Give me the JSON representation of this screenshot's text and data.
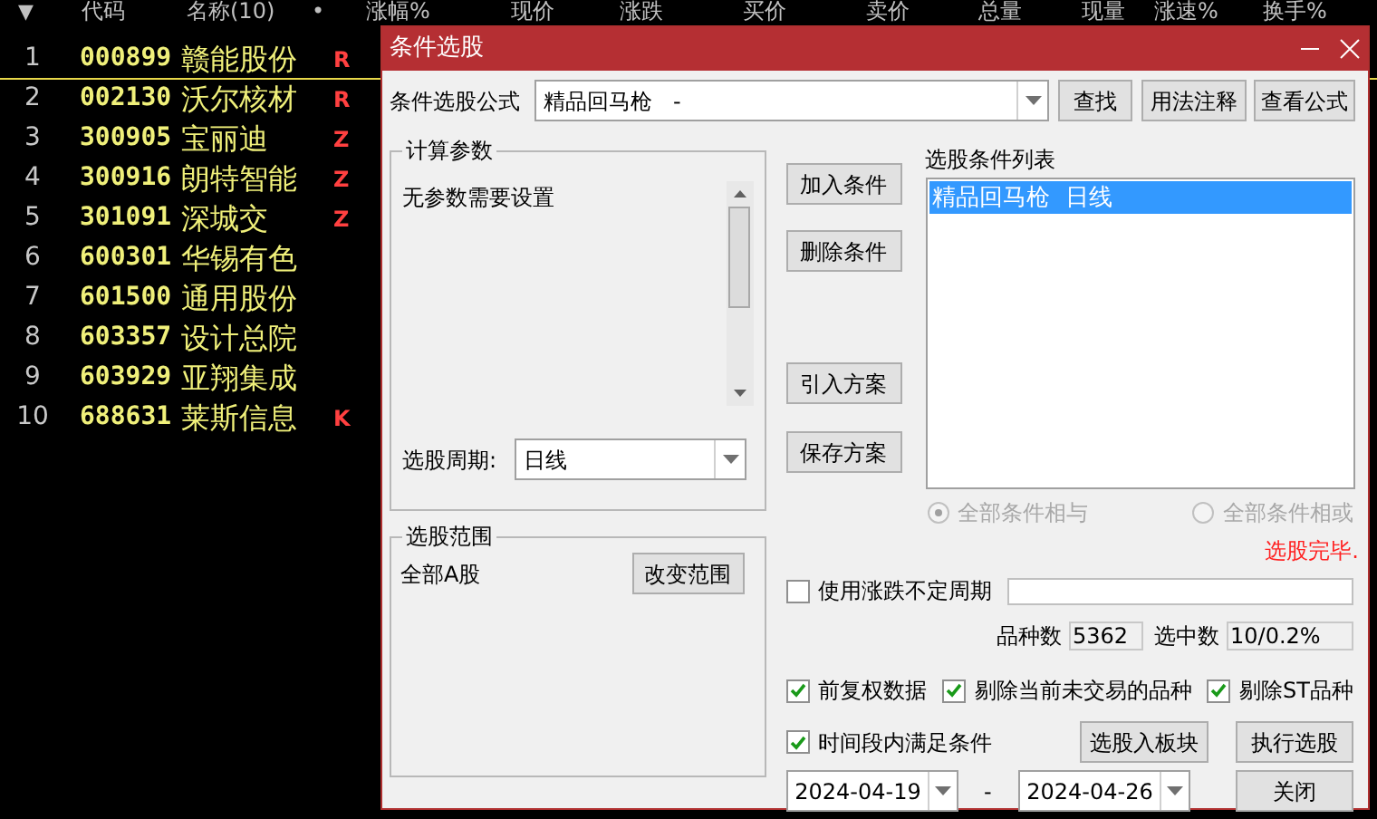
{
  "header": {
    "sort_icon": "▼",
    "columns": [
      "代码",
      "名称(10)",
      "•",
      "涨幅%",
      "现价",
      "涨跌",
      "买价",
      "卖价",
      "总量",
      "现量",
      "涨速%",
      "换手%"
    ]
  },
  "rows": [
    {
      "index": "1",
      "code": "000899",
      "name": "赣能股份",
      "mark": "R",
      "selected": true
    },
    {
      "index": "2",
      "code": "002130",
      "name": "沃尔核材",
      "mark": "R",
      "selected": false
    },
    {
      "index": "3",
      "code": "300905",
      "name": "宝丽迪",
      "mark": "Z",
      "selected": false
    },
    {
      "index": "4",
      "code": "300916",
      "name": "朗特智能",
      "mark": "Z",
      "selected": false
    },
    {
      "index": "5",
      "code": "301091",
      "name": "深城交",
      "mark": "Z",
      "selected": false
    },
    {
      "index": "6",
      "code": "600301",
      "name": "华锡有色",
      "selected": false
    },
    {
      "index": "7",
      "code": "601500",
      "name": "通用股份",
      "selected": false
    },
    {
      "index": "8",
      "code": "603357",
      "name": "设计总院",
      "selected": false
    },
    {
      "index": "9",
      "code": "603929",
      "name": "亚翔集成",
      "selected": false
    },
    {
      "index": "10",
      "code": "688631",
      "name": "莱斯信息",
      "mark": "K",
      "selected": false
    }
  ],
  "dialog": {
    "title": "条件选股",
    "formula_label": "条件选股公式",
    "formula_value": "精品回马枪   -",
    "top_buttons": [
      "查找",
      "用法注释",
      "查看公式"
    ],
    "params": {
      "title": "计算参数",
      "message": "无参数需要设置"
    },
    "period": {
      "label": "选股周期:",
      "value": "日线"
    },
    "range": {
      "title": "选股范围",
      "value": "全部A股",
      "button": "改变范围"
    },
    "middle_buttons": [
      "加入条件",
      "删除条件",
      "引入方案",
      "保存方案"
    ],
    "condition_list": {
      "label": "选股条件列表",
      "items": [
        {
          "text": "精品回马枪  日线",
          "selected": true
        }
      ]
    },
    "logic": [
      {
        "label": "全部条件相与",
        "selected": true,
        "disabled": true
      },
      {
        "label": "全部条件相或",
        "selected": false,
        "disabled": true
      }
    ],
    "status": "选股完毕.",
    "variable_period": {
      "label": "使用涨跌不定周期",
      "checked": false
    },
    "count": {
      "label": "品种数",
      "value": "5362"
    },
    "selected_count": {
      "label": "选中数",
      "value": "10/0.2%"
    },
    "options": [
      {
        "label": "前复权数据",
        "checked": true
      },
      {
        "label": "剔除当前未交易的品种",
        "checked": true
      },
      {
        "label": "剔除ST品种",
        "checked": true
      }
    ],
    "time_range": {
      "label": "时间段内满足条件",
      "checked": true
    },
    "add_to_block": "选股入板块",
    "run": "执行选股",
    "date_from": "2024-04-19",
    "date_separator": "-",
    "date_to": "2024-04-26",
    "close": "关闭"
  }
}
